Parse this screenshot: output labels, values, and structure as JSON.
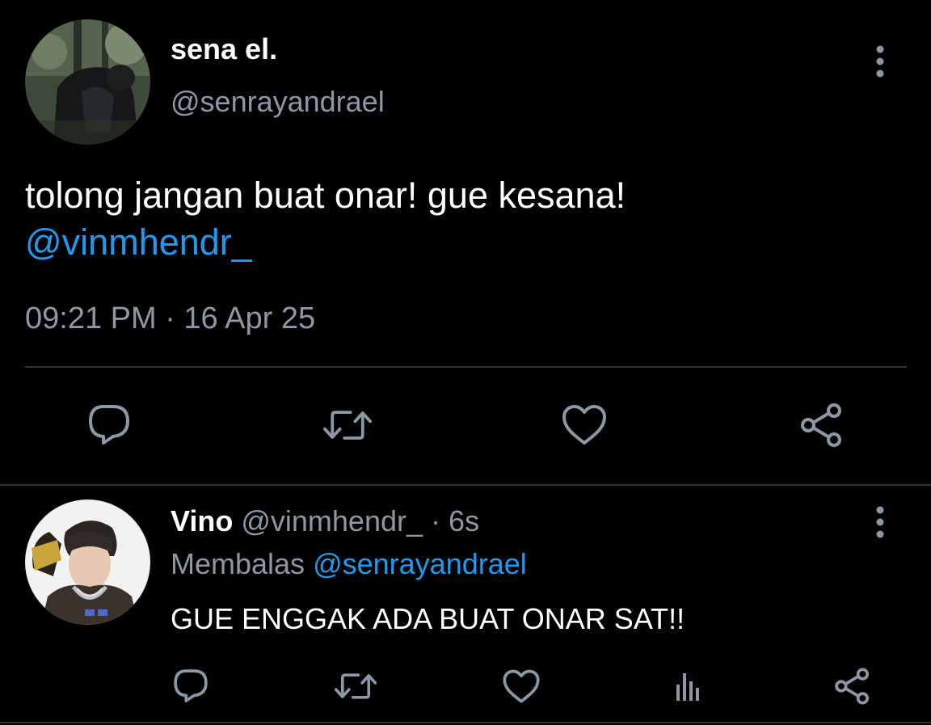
{
  "colors": {
    "background": "#000000",
    "text": "#ffffff",
    "secondary": "#8b98a5",
    "link": "#1d9bf0",
    "divider": "#2f3336"
  },
  "main_tweet": {
    "display_name": "sena el.",
    "handle": "@senrayandrael",
    "text": "tolong jangan buat onar! gue kesana!",
    "mention": "@vinmhendr_",
    "timestamp": "09:21 PM · 16 Apr 25",
    "avatar_icon": "profile-photo",
    "actions": [
      "reply-icon",
      "retweet-icon",
      "like-icon",
      "share-icon"
    ]
  },
  "reply": {
    "display_name": "Vino",
    "handle": "@vinmhendr_",
    "separator": "·",
    "age": "6s",
    "replying_label": "Membalas",
    "replying_to": "@senrayandrael",
    "text": "GUE ENGGAK ADA BUAT ONAR SAT!!",
    "avatar_icon": "profile-photo",
    "actions": [
      "reply-icon",
      "retweet-icon",
      "like-icon",
      "analytics-icon",
      "share-icon"
    ]
  }
}
